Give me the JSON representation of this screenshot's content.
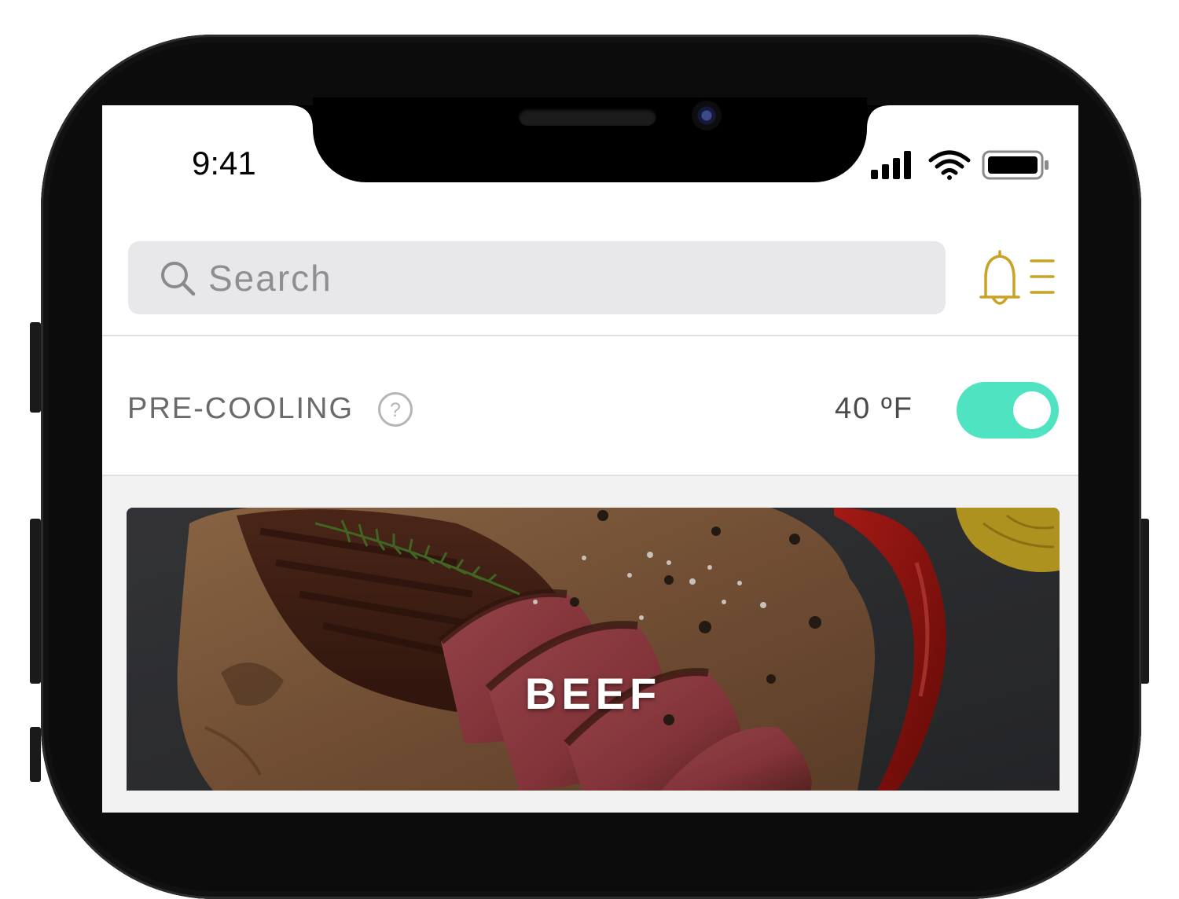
{
  "status_bar": {
    "time": "9:41"
  },
  "search": {
    "placeholder": "Search"
  },
  "precooling": {
    "label": "PRE-COOLING",
    "help_symbol": "?",
    "temperature": "40 ºF",
    "enabled": true
  },
  "category_card": {
    "title": "BEEF"
  },
  "icons": {
    "search": "search-icon",
    "notifications": "bell-menu-icon",
    "help": "question-circle-icon",
    "signal": "cellular-signal-icon",
    "wifi": "wifi-icon",
    "battery": "battery-icon"
  },
  "colors": {
    "accent_gold": "#c9a227",
    "toggle_on": "#4fe3c2",
    "search_bg": "#e8e8ea"
  }
}
